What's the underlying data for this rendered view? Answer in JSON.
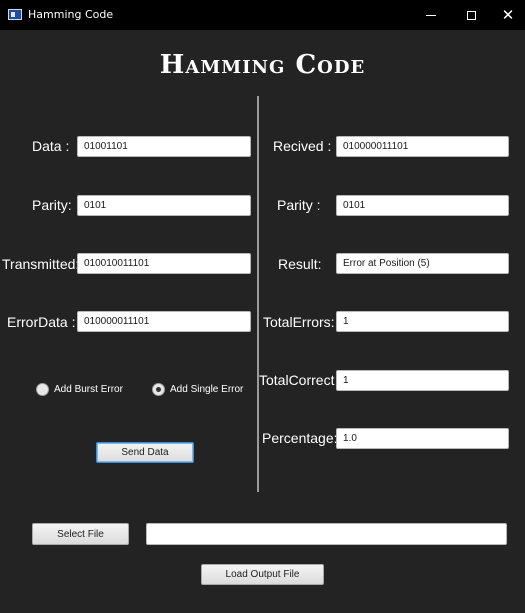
{
  "window": {
    "title": "Hamming Code",
    "minimize": "—",
    "maximize": "",
    "close": "✕"
  },
  "heading": "Hamming Code",
  "left": {
    "data_label": "Data :",
    "data_value": "01001101",
    "parity_label": "Parity:",
    "parity_value": "0101",
    "transmitted_label": "Transmitted:",
    "transmitted_value": "010010011101",
    "errordata_label": "ErrorData :",
    "errordata_value": "010000011101",
    "burst_label": "Add Burst Error",
    "single_label": "Add Single Error",
    "send_button": "Send Data"
  },
  "right": {
    "received_label": "Recived :",
    "received_value": "010000011101",
    "parity_label": "Parity :",
    "parity_value": "0101",
    "result_label": "Result:",
    "result_value": "Error at Position (5)",
    "total_errors_label": "TotalErrors:",
    "total_errors_value": "1",
    "total_correct_label": "TotalCorrect",
    "total_correct_value": "1",
    "percentage_label": "Percentage:",
    "percentage_value": "1.0"
  },
  "bottom": {
    "select_file_button": "Select File",
    "file_path_value": "",
    "load_output_button": "Load Output File"
  },
  "radio_state": {
    "burst_selected": false,
    "single_selected": true
  }
}
